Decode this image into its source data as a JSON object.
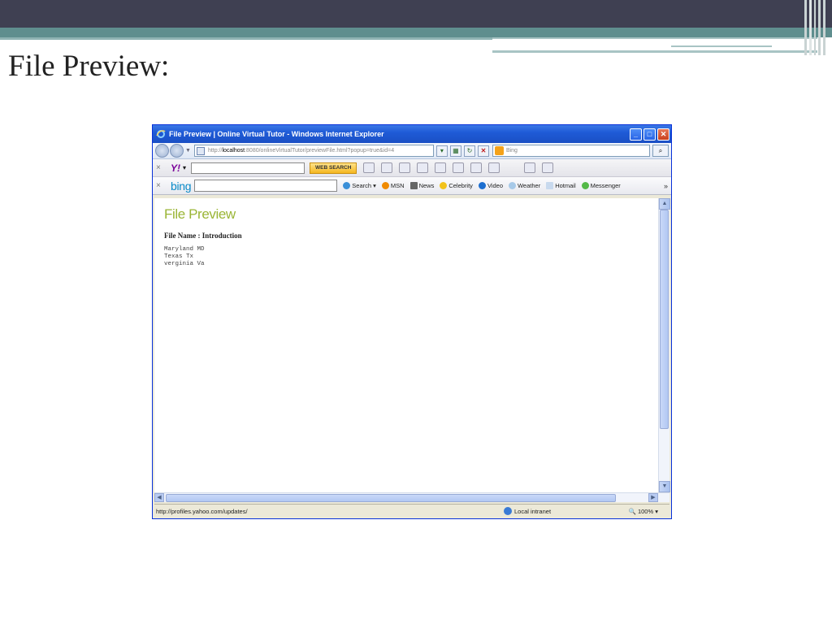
{
  "slide": {
    "title": "File Preview:"
  },
  "browser": {
    "window_title": "File Preview | Online Virtual Tutor - Windows Internet Explorer",
    "address_prefix": "http://",
    "address_host": "localhost",
    "address_rest": ":8080/onlineVirtualTutor/previewFile.html?popup=true&id=4",
    "search_provider": "Bing",
    "yahoo_toolbar": {
      "web_search_label": "WEB SEARCH"
    },
    "bing_toolbar": {
      "logo": "bing",
      "items": [
        "Search",
        "MSN",
        "News",
        "Celebrity",
        "Video",
        "Weather",
        "Hotmail",
        "Messenger"
      ]
    },
    "status": {
      "url": "http://profiles.yahoo.com/updates/",
      "zone": "Local intranet",
      "zoom": "100%"
    }
  },
  "page": {
    "heading": "File Preview",
    "file_name_label": "File Name : Introduction",
    "file_lines": [
      "Maryland MD",
      "Texas Tx",
      "verginia Va"
    ]
  },
  "colors": {
    "header_dark": "#3f4052",
    "header_teal": "#5f8e8e",
    "xp_blue": "#1f5bd7",
    "page_heading": "#9ab535"
  }
}
